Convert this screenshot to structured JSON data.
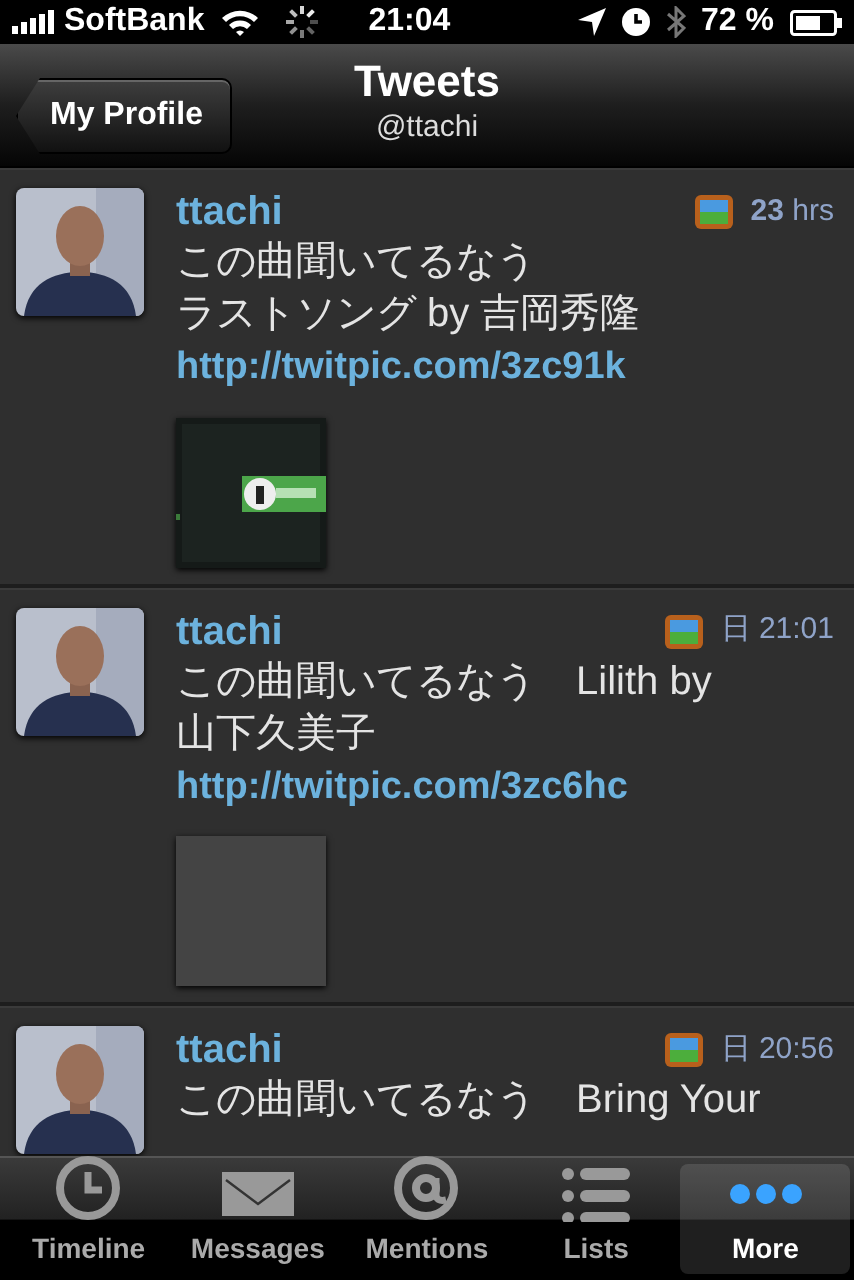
{
  "status_bar": {
    "carrier": "SoftBank",
    "time": "21:04",
    "battery": "72 %"
  },
  "nav_bar": {
    "back_button": "My Profile",
    "title": "Tweets",
    "subtitle": "@ttachi"
  },
  "tweets": [
    {
      "user": "ttachi",
      "time": "**23** hrs",
      "lines": [
        "この曲聞いてるなう",
        "ラストソング by 吉岡秀隆"
      ],
      "link": "http://twitpic.com/3zc91k",
      "thumbnail": {
        "kind": "picture"
      }
    },
    {
      "user": "ttachi",
      "time": "日 21:01",
      "lines": [
        "この曲聞いてるなう　Lilith by",
        "山下久美子"
      ],
      "link": "http://twitpic.com/3zc6hc",
      "thumbnail": {
        "kind": "placeholder"
      }
    },
    {
      "user": "ttachi",
      "time": "日 20:56",
      "lines": [
        "この曲聞いてるなう　Bring Your"
      ]
    }
  ],
  "tab_bar": [
    {
      "label": "Timeline",
      "selected": false
    },
    {
      "label": "Messages",
      "selected": false
    },
    {
      "label": "Mentions",
      "selected": false
    },
    {
      "label": "Lists",
      "selected": false
    },
    {
      "label": "More",
      "selected": true
    }
  ]
}
